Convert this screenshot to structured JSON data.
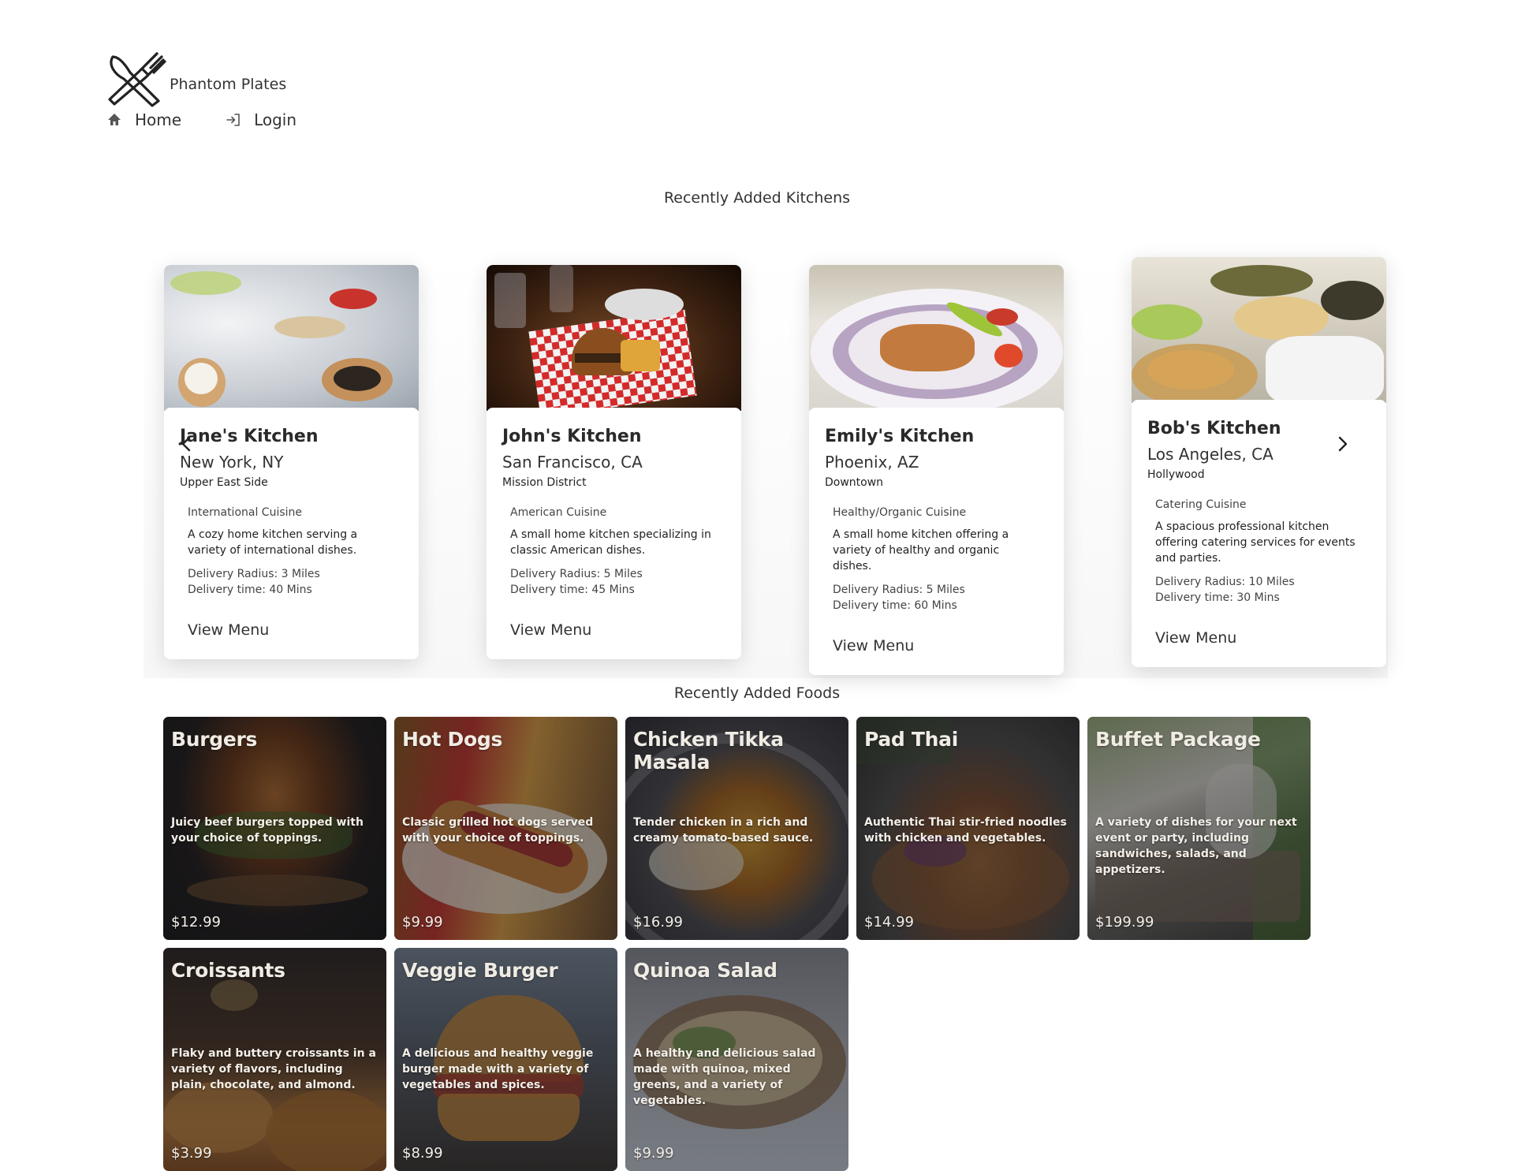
{
  "header": {
    "brand_name": "Phantom Plates",
    "logo_icon": "crossed-fork-knife-icon",
    "nav": [
      {
        "label": "Home",
        "icon": "home-icon"
      },
      {
        "label": "Login",
        "icon": "login-icon"
      }
    ]
  },
  "kitchens": {
    "title": "Recently Added Kitchens",
    "prev_icon": "chevron-left-icon",
    "next_icon": "chevron-right-icon",
    "items": [
      {
        "name": "Jane's Kitchen",
        "city": "New York, NY",
        "area": "Upper East Side",
        "cuisine": "International Cuisine",
        "description": "A cozy home kitchen serving a variety of international dishes.",
        "radius": "Delivery Radius: 3 Miles",
        "time": "Delivery time: 40 Mins",
        "action": "View Menu"
      },
      {
        "name": "John's Kitchen",
        "city": "San Francisco, CA",
        "area": "Mission District",
        "cuisine": "American Cuisine",
        "description": "A small home kitchen specializing in classic American dishes.",
        "radius": "Delivery Radius: 5 Miles",
        "time": "Delivery time: 45 Mins",
        "action": "View Menu"
      },
      {
        "name": "Emily's Kitchen",
        "city": "Phoenix, AZ",
        "area": "Downtown",
        "cuisine": "Healthy/Organic Cuisine",
        "description": "A small home kitchen offering a variety of healthy and organic dishes.",
        "radius": "Delivery Radius: 5 Miles",
        "time": "Delivery time: 60 Mins",
        "action": "View Menu"
      },
      {
        "name": "Bob's Kitchen",
        "city": "Los Angeles, CA",
        "area": "Hollywood",
        "cuisine": "Catering Cuisine",
        "description": "A spacious professional kitchen offering catering services for events and parties.",
        "radius": "Delivery Radius: 10 Miles",
        "time": "Delivery time: 30 Mins",
        "action": "View Menu"
      }
    ]
  },
  "foods": {
    "title": "Recently Added Foods",
    "items": [
      {
        "name": "Burgers",
        "description": "Juicy beef burgers topped with your choice of toppings.",
        "price": "$12.99"
      },
      {
        "name": "Hot Dogs",
        "description": "Classic grilled hot dogs served with your choice of toppings.",
        "price": "$9.99"
      },
      {
        "name": "Chicken Tikka Masala",
        "description": "Tender chicken in a rich and creamy tomato-based sauce.",
        "price": "$16.99"
      },
      {
        "name": "Pad Thai",
        "description": "Authentic Thai stir-fried noodles with chicken and vegetables.",
        "price": "$14.99"
      },
      {
        "name": "Buffet Package",
        "description": "A variety of dishes for your next event or party, including sandwiches, salads, and appetizers.",
        "price": "$199.99"
      },
      {
        "name": "Croissants",
        "description": "Flaky and buttery croissants in a variety of flavors, including plain, chocolate, and almond.",
        "price": "$3.99"
      },
      {
        "name": "Veggie Burger",
        "description": "A delicious and healthy veggie burger made with a variety of vegetables and spices.",
        "price": "$8.99"
      },
      {
        "name": "Quinoa Salad",
        "description": "A healthy and delicious salad made with quinoa, mixed greens, and a variety of vegetables.",
        "price": "$9.99"
      }
    ]
  }
}
